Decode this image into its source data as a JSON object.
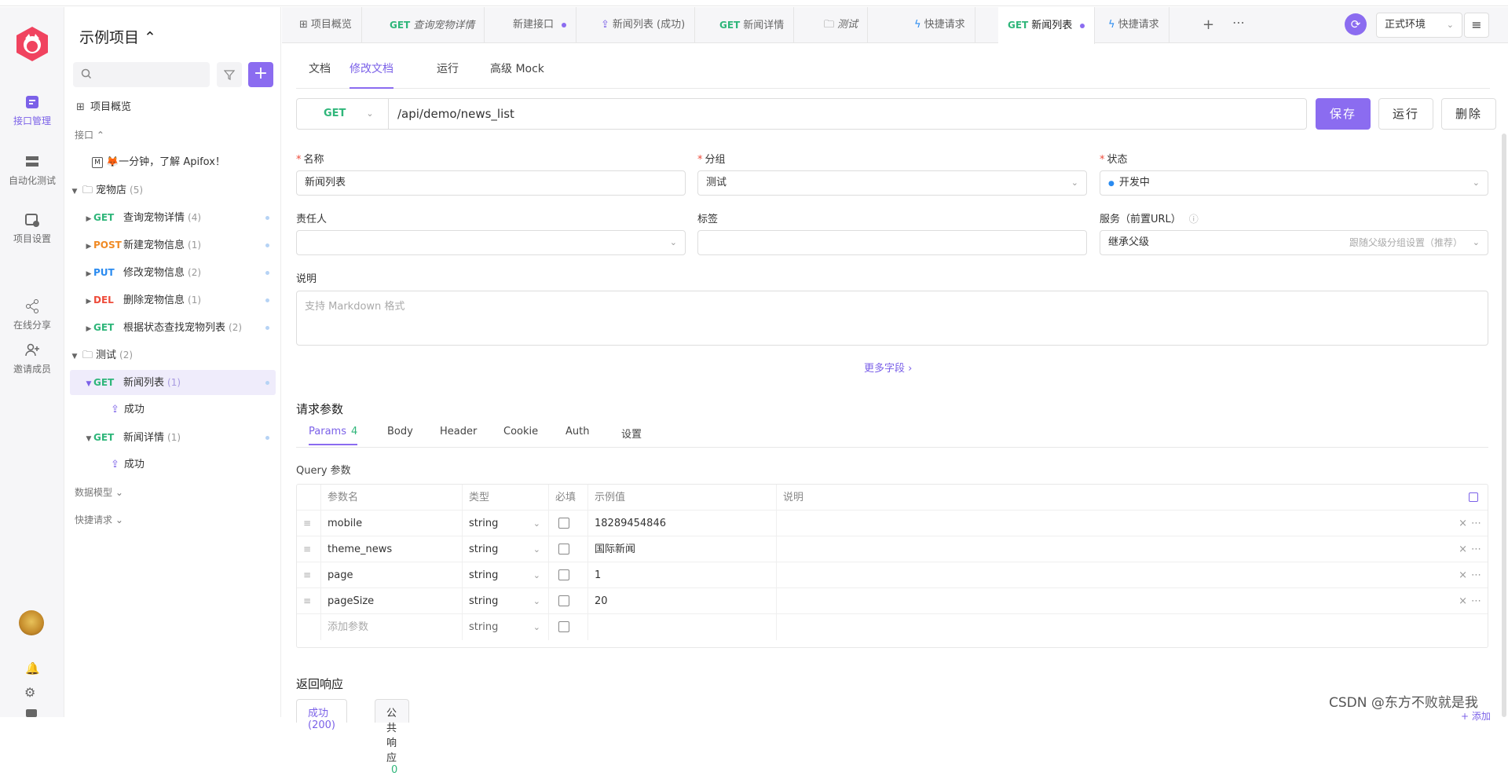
{
  "rail": {
    "items": [
      {
        "label": "接口管理",
        "icon": "api-icon"
      },
      {
        "label": "自动化测试",
        "icon": "automation-icon"
      },
      {
        "label": "项目设置",
        "icon": "settings-icon"
      },
      {
        "label": "在线分享",
        "icon": "share-icon"
      },
      {
        "label": "邀请成员",
        "icon": "invite-icon"
      }
    ],
    "accent": "#7b61e8"
  },
  "sidebar": {
    "project_title": "示例项目 ⌃",
    "overview": "项目概览",
    "api_section": "接口 ⌃",
    "welcome": "🦊一分钟，了解 Apifox！",
    "folder_pets": {
      "name": "宠物店",
      "count": "(5)"
    },
    "pets": [
      {
        "method": "GET",
        "name": "查询宠物详情",
        "count": "(4)"
      },
      {
        "method": "POST",
        "name": "新建宠物信息",
        "count": "(1)"
      },
      {
        "method": "PUT",
        "name": "修改宠物信息",
        "count": "(2)"
      },
      {
        "method": "DEL",
        "name": "删除宠物信息",
        "count": "(1)"
      },
      {
        "method": "GET",
        "name": "根据状态查找宠物列表",
        "count": "(2)"
      }
    ],
    "folder_test": {
      "name": "测试",
      "count": "(2)"
    },
    "tests": [
      {
        "method": "GET",
        "name": "新闻列表",
        "count": "(1)",
        "child": "成功"
      },
      {
        "method": "GET",
        "name": "新闻详情",
        "count": "(1)",
        "child": "成功"
      }
    ],
    "data_model": "数据模型 ⌄",
    "quick_request": "快捷请求 ⌄"
  },
  "tabs": [
    {
      "method": "",
      "label": "项目概览",
      "icon": "grid-icon"
    },
    {
      "method": "GET",
      "label": "查询宠物详情",
      "italic": true
    },
    {
      "method": "",
      "label": "新建接口",
      "dot": true
    },
    {
      "method": "",
      "label": "新闻列表 (成功)",
      "icon": "response-icon"
    },
    {
      "method": "GET",
      "label": "新闻详情"
    },
    {
      "method": "",
      "label": "测试",
      "icon": "folder-icon",
      "italic": true
    },
    {
      "method": "",
      "label": "快捷请求",
      "icon": "bolt-icon"
    },
    {
      "method": "GET",
      "label": "新闻列表",
      "active": true,
      "dot": true
    },
    {
      "method": "",
      "label": "快捷请求",
      "icon": "bolt-icon"
    }
  ],
  "env": {
    "label": "正式环境"
  },
  "subtabs": [
    "文档",
    "修改文档",
    "运行",
    "高级 Mock"
  ],
  "request": {
    "method": "GET",
    "path": "/api/demo/news_list",
    "save": "保存",
    "run": "运行",
    "delete": "删除"
  },
  "form": {
    "name_label": "名称",
    "name_value": "新闻列表",
    "group_label": "分组",
    "group_value": "测试",
    "status_label": "状态",
    "status_value": "开发中",
    "owner_label": "责任人",
    "tag_label": "标签",
    "service_label": "服务（前置URL）",
    "service_value": "继承父级",
    "service_hint": "跟随父级分组设置（推荐）",
    "desc_label": "说明",
    "desc_placeholder": "支持 Markdown 格式",
    "more": "更多字段 ›"
  },
  "params": {
    "section": "请求参数",
    "tabs": [
      {
        "label": "Params",
        "count": "4"
      },
      {
        "label": "Body"
      },
      {
        "label": "Header"
      },
      {
        "label": "Cookie"
      },
      {
        "label": "Auth"
      },
      {
        "label": "设置"
      }
    ],
    "query_label": "Query 参数",
    "headers": [
      "参数名",
      "类型",
      "必填",
      "示例值",
      "说明"
    ],
    "rows": [
      {
        "name": "mobile",
        "type": "string",
        "example": "18289454846"
      },
      {
        "name": "theme_news",
        "type": "string",
        "example": "国际新闻"
      },
      {
        "name": "page",
        "type": "string",
        "example": "1"
      },
      {
        "name": "pageSize",
        "type": "string",
        "example": "20"
      }
    ],
    "add_placeholder": "添加参数",
    "add_type": "string"
  },
  "response": {
    "section": "返回响应",
    "tabs": [
      {
        "label": "成功 (200)"
      },
      {
        "label": "公共响应",
        "count": "0"
      }
    ],
    "add": "+ 添加"
  },
  "watermark": "CSDN @东方不败就是我"
}
